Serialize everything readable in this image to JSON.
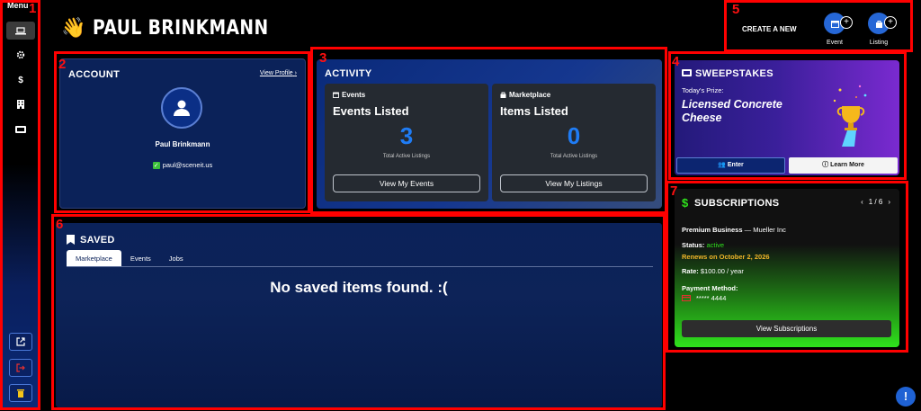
{
  "sidebar": {
    "menu_label": "Menu",
    "items": [
      {
        "icon": "laptop-icon",
        "active": true
      },
      {
        "icon": "gear-icon"
      },
      {
        "icon": "dollar-icon"
      },
      {
        "icon": "building-icon"
      },
      {
        "icon": "ticket-icon"
      }
    ],
    "bottom": [
      {
        "icon": "external-link-icon"
      },
      {
        "icon": "logout-icon"
      },
      {
        "icon": "trash-icon"
      }
    ]
  },
  "header": {
    "wave": "👋",
    "name": "PAUL BRINKMANN"
  },
  "create": {
    "label": "CREATE A NEW",
    "event_label": "Event",
    "listing_label": "Listing"
  },
  "account": {
    "title": "ACCOUNT",
    "view_profile": "View Profile",
    "name": "Paul Brinkmann",
    "email": "paul@sceneit.us"
  },
  "activity": {
    "title": "ACTIVITY",
    "events": {
      "sub": "Events",
      "heading": "Events Listed",
      "count": "3",
      "note": "Total Active Listings",
      "button": "View My Events"
    },
    "marketplace": {
      "sub": "Marketplace",
      "heading": "Items Listed",
      "count": "0",
      "note": "Total Active Listings",
      "button": "View My Listings"
    }
  },
  "sweepstakes": {
    "title": "SWEEPSTAKES",
    "prize_label": "Today's Prize:",
    "prize": "Licensed Concrete Cheese",
    "enter": "Enter",
    "learn_more": "Learn More"
  },
  "subscriptions": {
    "dollar": "$",
    "title": "SUBSCRIPTIONS",
    "pager": "1 / 6",
    "plan": "Premium Business",
    "company": "Mueller Inc",
    "status_label": "Status:",
    "status": "active",
    "renews": "Renews on October 2, 2026",
    "rate_label": "Rate:",
    "rate": "$100.00 / year",
    "payment_label": "Payment Method:",
    "card": "***** 4444",
    "button": "View Subscriptions"
  },
  "saved": {
    "title": "SAVED",
    "tabs": [
      "Marketplace",
      "Events",
      "Jobs"
    ],
    "empty": "No saved items found. :("
  },
  "annotations": [
    "1",
    "2",
    "3",
    "4",
    "5",
    "6",
    "7"
  ],
  "help": "!",
  "colors": {
    "accent": "#1f7cf5",
    "annotation": "#ff0000",
    "status_active": "#2fe21c",
    "renew": "#f0b429"
  }
}
